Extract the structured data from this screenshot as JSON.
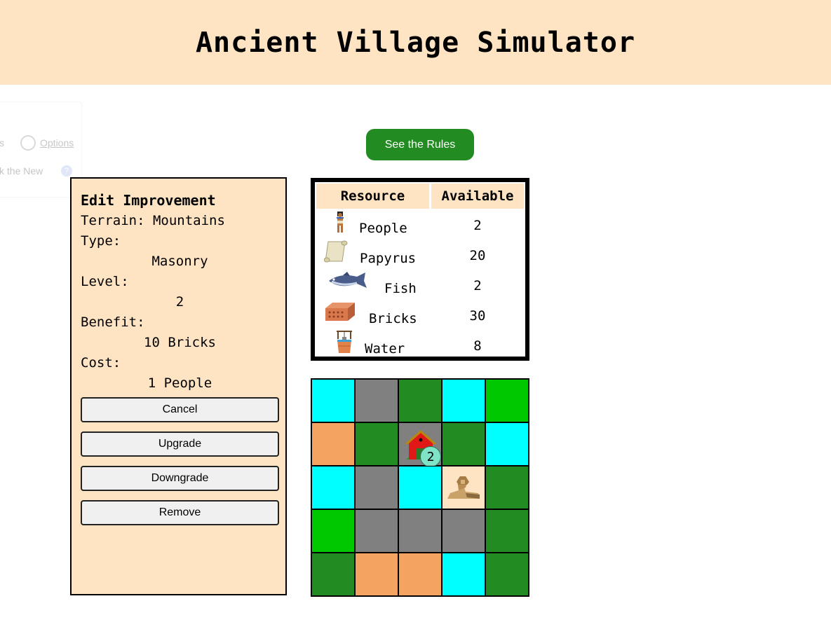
{
  "header": {
    "title": "Ancient Village Simulator"
  },
  "background_widget": {
    "partial_text_1": "s",
    "options_link": "Options",
    "partial_text_2": "k the New",
    "help_glyph": "?"
  },
  "rules_button": {
    "label": "See the Rules",
    "color": "#228b22"
  },
  "edit_panel": {
    "title": "Edit Improvement",
    "terrain_line": "Terrain: Mountains",
    "type_label": "Type:",
    "type_value": "Masonry",
    "level_label": "Level:",
    "level_value": "2",
    "benefit_label": "Benefit:",
    "benefit_value": "10 Bricks",
    "cost_label": "Cost:",
    "cost_value": "1 People",
    "buttons": {
      "cancel": "Cancel",
      "upgrade": "Upgrade",
      "downgrade": "Downgrade",
      "remove": "Remove"
    },
    "background": "#ffe4c4"
  },
  "resources": {
    "headers": {
      "resource": "Resource",
      "available": "Available"
    },
    "rows": [
      {
        "name": "People",
        "count": "2",
        "icon": "egyptian-figure-icon"
      },
      {
        "name": "Papyrus",
        "count": "20",
        "icon": "papyrus-scroll-icon"
      },
      {
        "name": "Fish",
        "count": "2",
        "icon": "fish-icon"
      },
      {
        "name": "Bricks",
        "count": "30",
        "icon": "brick-icon"
      },
      {
        "name": "Water",
        "count": "8",
        "icon": "water-well-icon"
      }
    ]
  },
  "map": {
    "terrain_colors": {
      "water": "#00ffff",
      "mountains": "#808080",
      "forest": "#228b22",
      "grassland": "#00c800",
      "desert": "#f4a460",
      "sand": "#ffe4c4"
    },
    "cells": [
      "water",
      "mountains",
      "forest",
      "water",
      "grassland",
      "desert",
      "forest",
      "mountains",
      "forest",
      "water",
      "water",
      "mountains",
      "water",
      "sand",
      "forest",
      "grassland",
      "mountains",
      "mountains",
      "mountains",
      "forest",
      "forest",
      "desert",
      "desert",
      "water",
      "forest"
    ],
    "improvements": [
      {
        "cell": 7,
        "icon": "red-house-icon",
        "level": "2"
      },
      {
        "cell": 13,
        "icon": "sphinx-icon"
      }
    ]
  }
}
